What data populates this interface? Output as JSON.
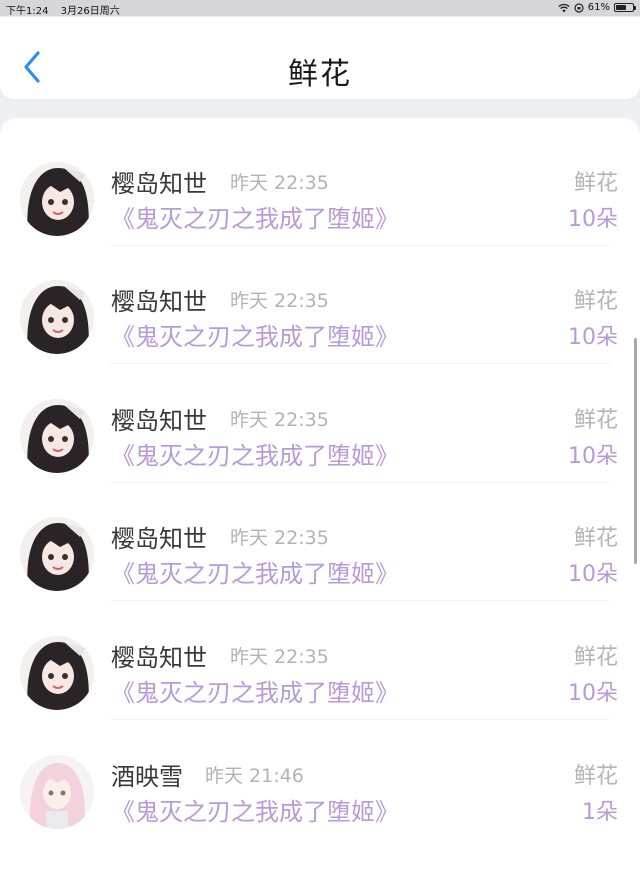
{
  "status_bar": {
    "time": "下午1:24",
    "date": "3月26日周六",
    "battery": "61%",
    "battery_level": 0.61
  },
  "nav": {
    "title": "鲜花"
  },
  "colors": {
    "accent": "#2f8ef5",
    "purple_text": "#b99ad8"
  },
  "list": {
    "items": [
      {
        "name": "樱岛知世",
        "time": "昨天 22:35",
        "book": "《鬼灭之刃之我成了堕姬》",
        "gift": "鲜花",
        "count": "10朵",
        "avatar": "anime-girl-dark-hair"
      },
      {
        "name": "樱岛知世",
        "time": "昨天 22:35",
        "book": "《鬼灭之刃之我成了堕姬》",
        "gift": "鲜花",
        "count": "10朵",
        "avatar": "anime-girl-dark-hair"
      },
      {
        "name": "樱岛知世",
        "time": "昨天 22:35",
        "book": "《鬼灭之刃之我成了堕姬》",
        "gift": "鲜花",
        "count": "10朵",
        "avatar": "anime-girl-dark-hair"
      },
      {
        "name": "樱岛知世",
        "time": "昨天 22:35",
        "book": "《鬼灭之刃之我成了堕姬》",
        "gift": "鲜花",
        "count": "10朵",
        "avatar": "anime-girl-dark-hair"
      },
      {
        "name": "樱岛知世",
        "time": "昨天 22:35",
        "book": "《鬼灭之刃之我成了堕姬》",
        "gift": "鲜花",
        "count": "10朵",
        "avatar": "anime-girl-dark-hair"
      },
      {
        "name": "酒映雪",
        "time": "昨天 21:46",
        "book": "《鬼灭之刃之我成了堕姬》",
        "gift": "鲜花",
        "count": "1朵",
        "avatar": "anime-girl-pink-hair"
      }
    ]
  }
}
